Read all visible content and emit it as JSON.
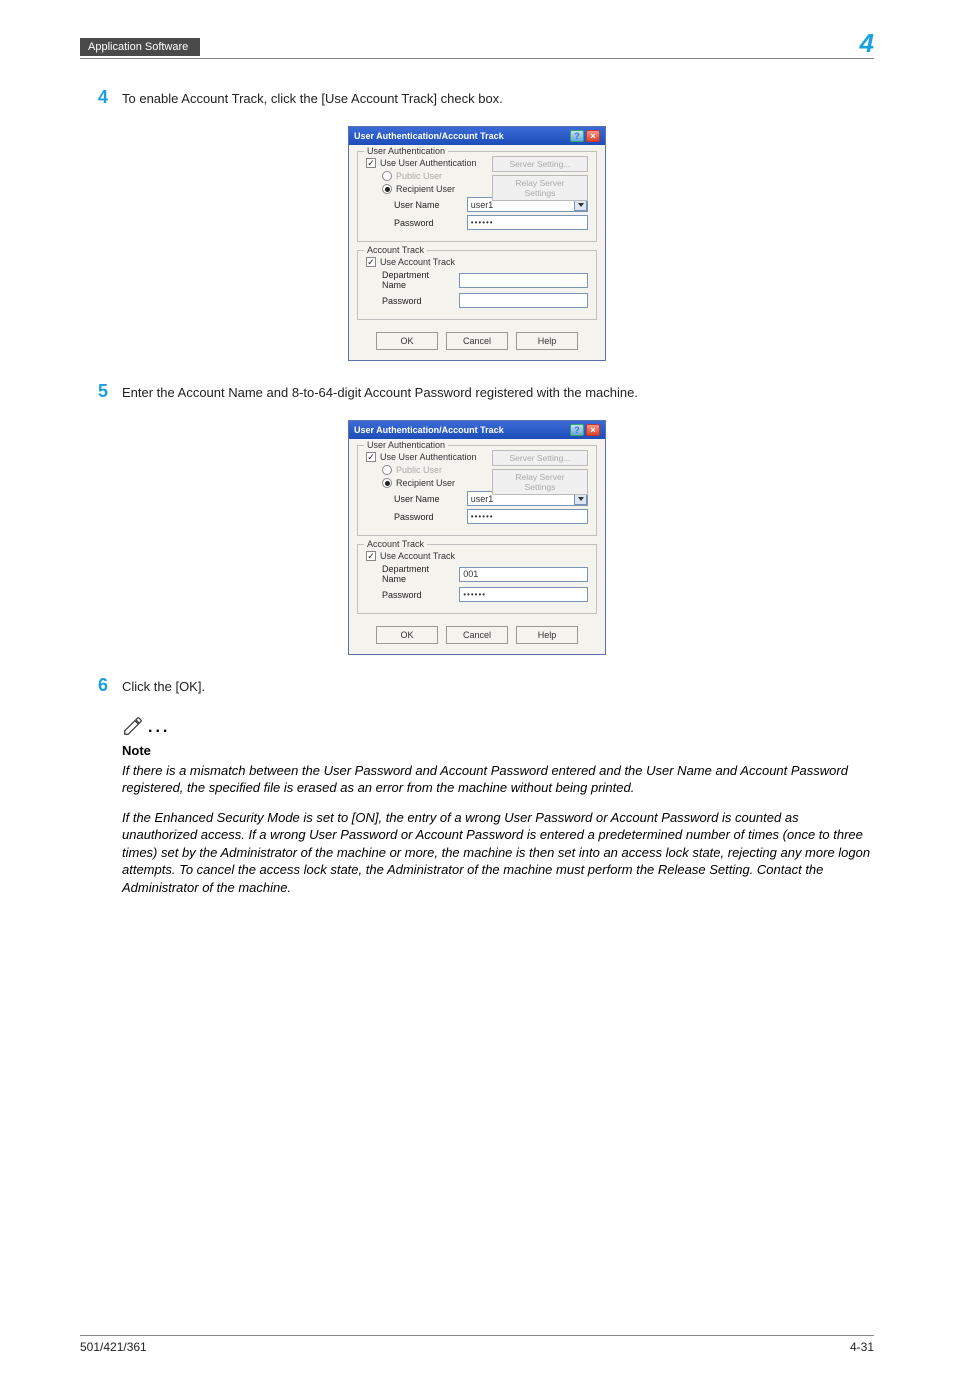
{
  "header": {
    "section": "Application Software",
    "chapter": "4"
  },
  "steps": {
    "s4": {
      "num": "4",
      "text": "To enable Account Track, click the [Use Account Track] check box."
    },
    "s5": {
      "num": "5",
      "text": "Enter the Account Name and 8-to-64-digit Account Password registered with the machine."
    },
    "s6": {
      "num": "6",
      "text": "Click the [OK]."
    }
  },
  "dialog": {
    "title": "User Authentication/Account Track",
    "ua": {
      "legend": "User Authentication",
      "use": "Use User Authentication",
      "public": "Public User",
      "recipient": "Recipient User",
      "username_label": "User Name",
      "username_value": "user1",
      "password_label": "Password",
      "password_value": "••••••",
      "server_setting": "Server Setting...",
      "relay_server": "Relay Server Settings"
    },
    "at": {
      "legend": "Account Track",
      "use": "Use Account Track",
      "dept_label": "Department Name",
      "dept_value_blank": "",
      "dept_value_filled": "001",
      "password_label": "Password",
      "password_value_blank": "",
      "password_value_filled": "••••••"
    },
    "buttons": {
      "ok": "OK",
      "cancel": "Cancel",
      "help": "Help"
    }
  },
  "note": {
    "label": "Note",
    "p1": "If there is a mismatch between the User Password and Account Password entered and the User Name and Account Password registered, the specified file is erased as an error from the machine without being printed.",
    "p2": "If the Enhanced Security Mode is set to [ON], the entry of a wrong User Password or Account Password is counted as unauthorized access. If a wrong User Password or Account Password is entered a predetermined number of times (once to three times) set by the Administrator of the machine or more, the machine is then set into an access lock state, rejecting any more logon attempts. To cancel the access lock state, the Administrator of the machine must perform the Release Setting. Contact the Administrator of the machine."
  },
  "footer": {
    "left": "501/421/361",
    "right": "4-31"
  }
}
